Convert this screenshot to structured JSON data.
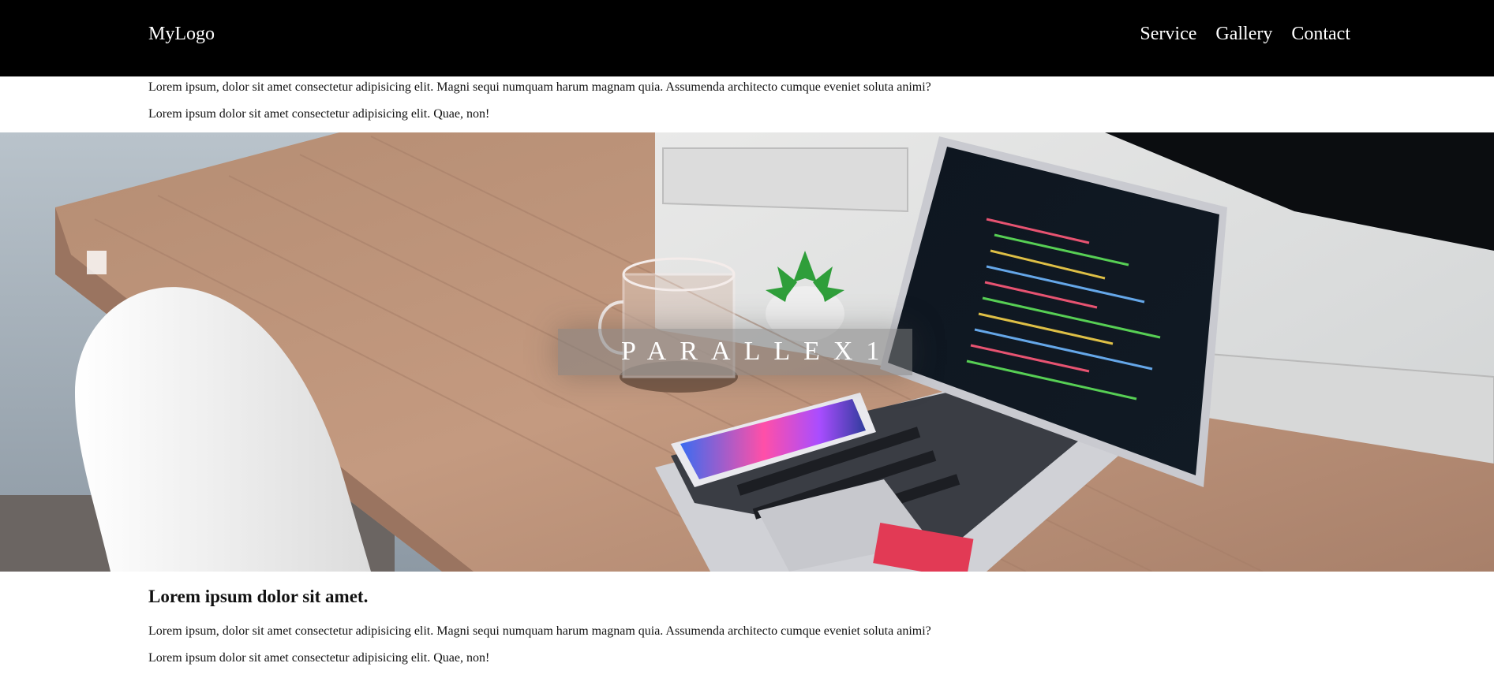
{
  "nav": {
    "logo": "MyLogo",
    "links": [
      "Service",
      "Gallery",
      "Contact"
    ]
  },
  "intro": {
    "paragraph_1": "Lorem ipsum, dolor sit amet consectetur adipisicing elit. Magni sequi numquam harum magnam quia. Assumenda architecto cumque eveniet soluta animi?",
    "paragraph_2": "Lorem ipsum dolor sit amet consectetur adipisicing elit. Quae, non!"
  },
  "hero": {
    "title": "PARALLEX1",
    "image": "desk-with-laptop-phone-plant-and-glass-photo"
  },
  "section": {
    "heading": "Lorem ipsum dolor sit amet.",
    "paragraph_1": "Lorem ipsum, dolor sit amet consectetur adipisicing elit. Magni sequi numquam harum magnam quia. Assumenda architecto cumque eveniet soluta animi?",
    "paragraph_2": "Lorem ipsum dolor sit amet consectetur adipisicing elit. Quae, non!"
  },
  "colors": {
    "navbar_bg": "#000000",
    "nav_text": "#ffffff",
    "page_bg": "#ffffff",
    "hero_overlay": "#808080"
  }
}
